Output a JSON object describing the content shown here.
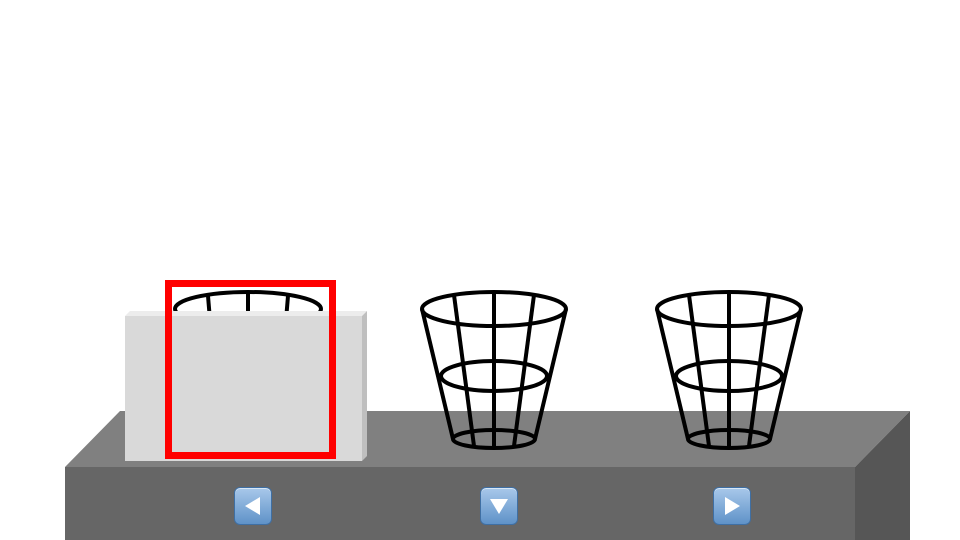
{
  "scene": {
    "table_top_color": "#808080",
    "table_front_color": "#666666",
    "table_side_color": "#565656",
    "box_color": "#d9d9d9",
    "selection_color": "#ff0000",
    "basket_stroke_color": "#000000"
  },
  "baskets": [
    {
      "name": "basket-1",
      "covered": true,
      "selected": true
    },
    {
      "name": "basket-2",
      "covered": false,
      "selected": false
    },
    {
      "name": "basket-3",
      "covered": false,
      "selected": false
    }
  ],
  "controls": {
    "button_color": "#6fa0d4",
    "left_icon": "triangle-left-icon",
    "down_icon": "triangle-down-icon",
    "right_icon": "triangle-right-icon"
  }
}
